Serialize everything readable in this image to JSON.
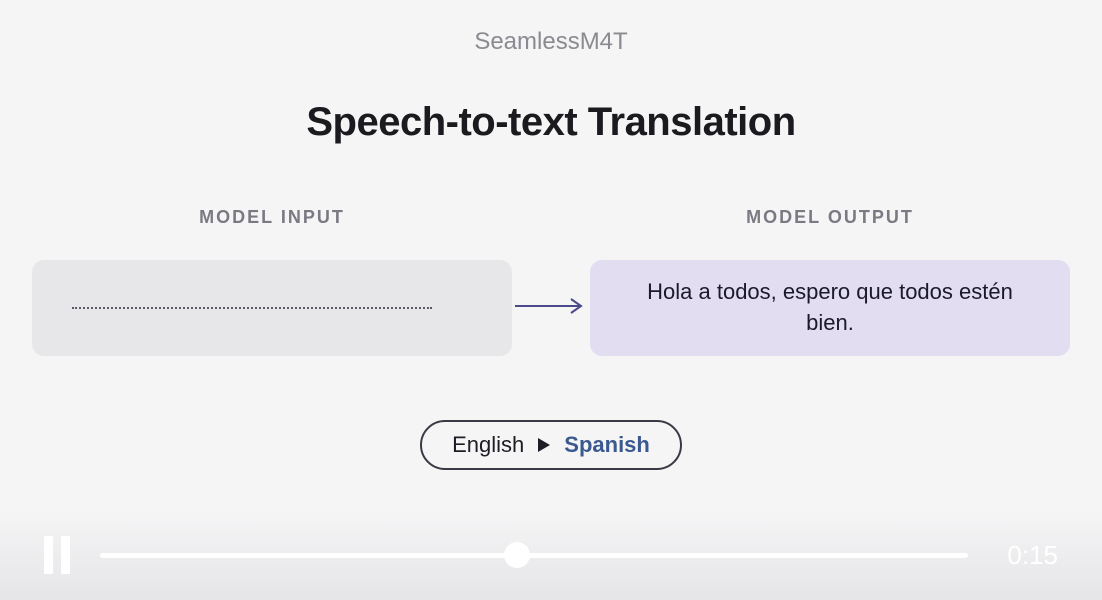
{
  "app": {
    "title": "SeamlessM4T"
  },
  "heading": "Speech-to-text Translation",
  "io": {
    "input_label": "MODEL INPUT",
    "output_label": "MODEL OUTPUT",
    "output_text": "Hola a todos, espero que todos estén bien."
  },
  "languages": {
    "from": "English",
    "to": "Spanish"
  },
  "player": {
    "time": "0:15",
    "progress_percent": 48
  },
  "colors": {
    "output_bg": "#e3ddf2",
    "input_bg": "#e7e7e9",
    "arrow": "#4a4a8a",
    "lang_to": "#3a5a8f"
  }
}
